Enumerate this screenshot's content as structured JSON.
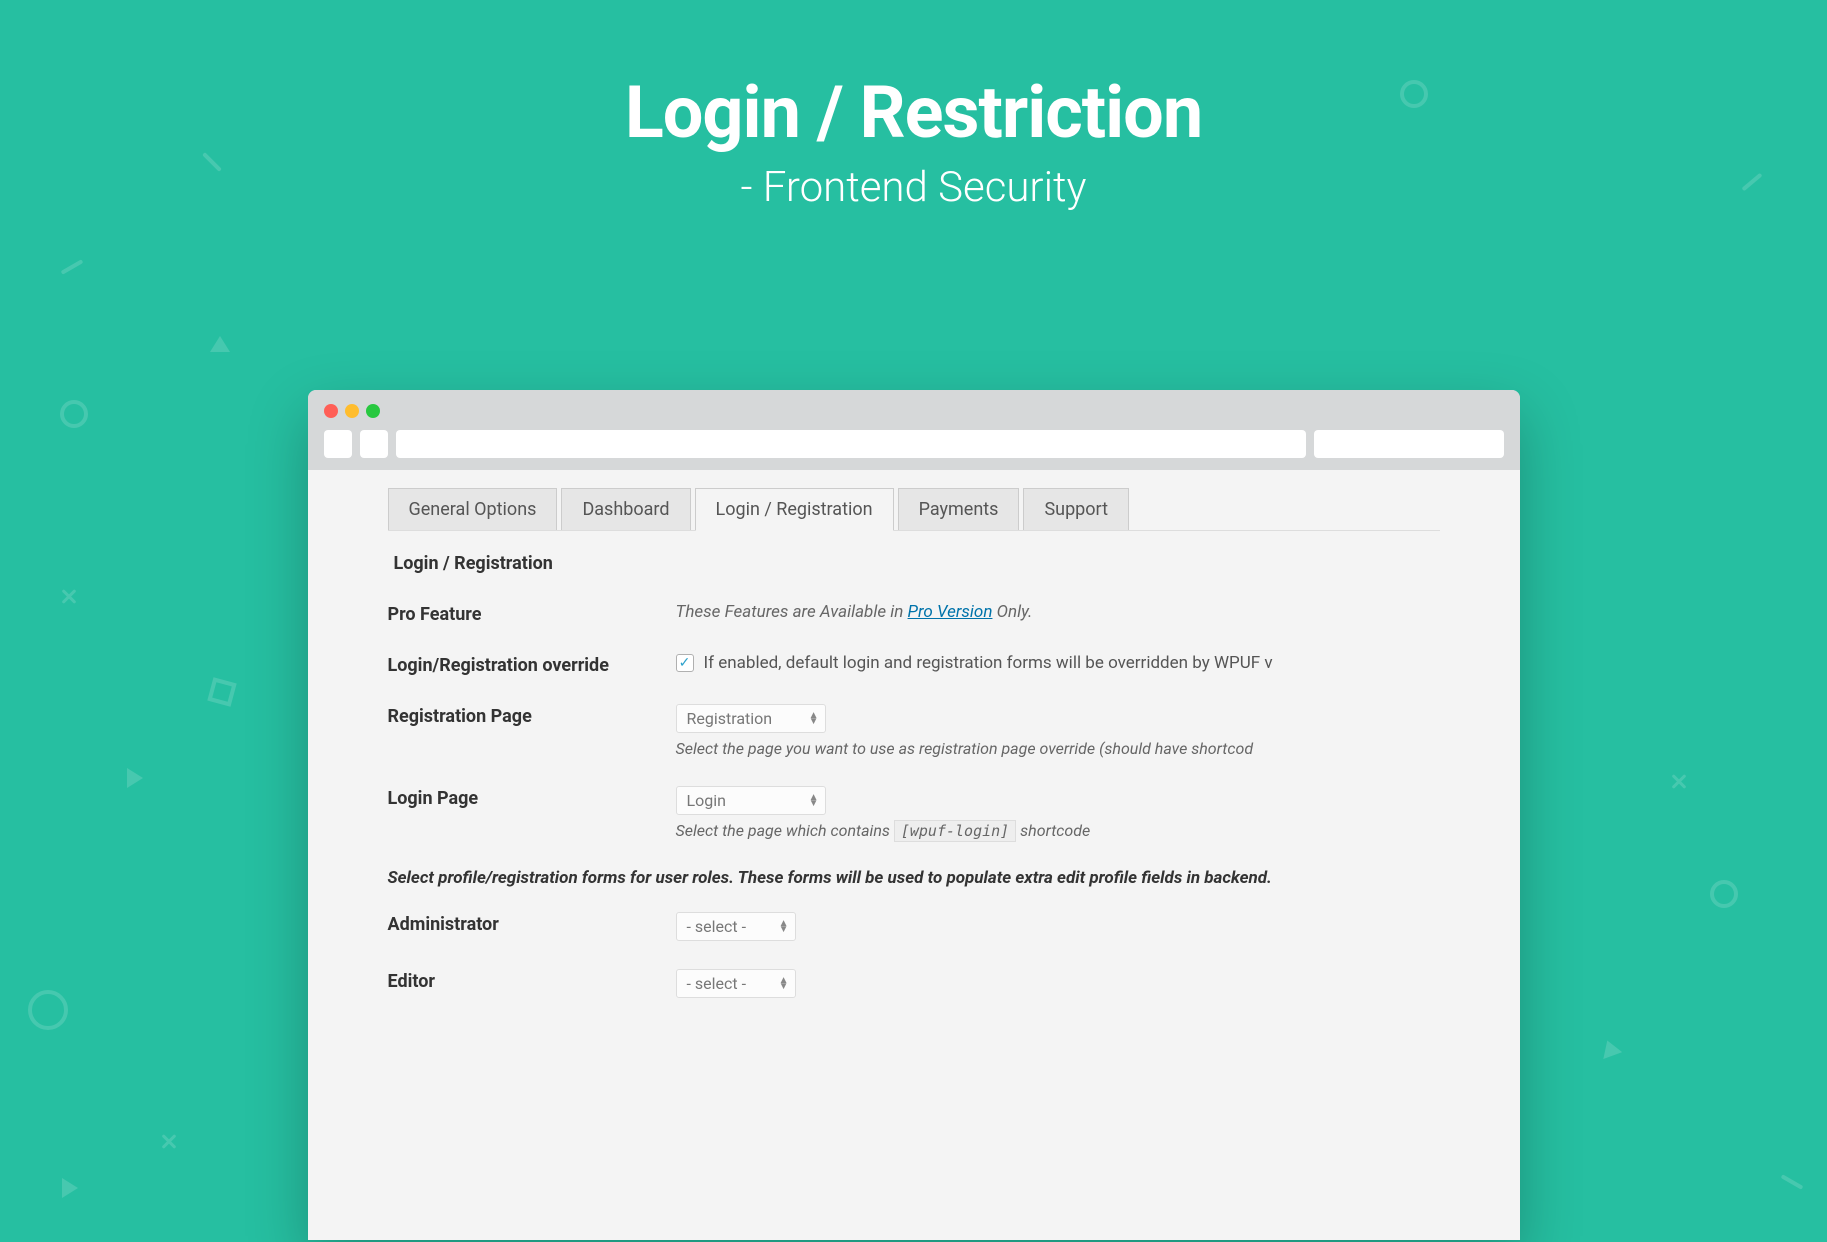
{
  "hero": {
    "title": "Login / Restriction",
    "subtitle": "- Frontend Security"
  },
  "tabs": [
    {
      "label": "General Options",
      "active": false
    },
    {
      "label": "Dashboard",
      "active": false
    },
    {
      "label": "Login / Registration",
      "active": true
    },
    {
      "label": "Payments",
      "active": false
    },
    {
      "label": "Support",
      "active": false
    }
  ],
  "section_title": "Login / Registration",
  "pro_feature": {
    "label": "Pro Feature",
    "desc_prefix": "These Features are Available in ",
    "link_text": "Pro Version",
    "desc_suffix": " Only."
  },
  "override": {
    "label": "Login/Registration override",
    "checked": true,
    "desc": "If enabled, default login and registration forms will be overridden by WPUF v"
  },
  "registration_page": {
    "label": "Registration Page",
    "value": "Registration",
    "desc": "Select the page you want to use as registration page override (should have shortcod"
  },
  "login_page": {
    "label": "Login Page",
    "value": "Login",
    "desc_prefix": "Select the page which contains ",
    "code": "[wpuf-login]",
    "desc_suffix": " shortcode"
  },
  "role_note": "Select profile/registration forms for user roles. These forms will be used to populate extra edit profile fields in backend.",
  "roles": [
    {
      "label": "Administrator",
      "value": "- select -"
    },
    {
      "label": "Editor",
      "value": "- select -"
    }
  ]
}
